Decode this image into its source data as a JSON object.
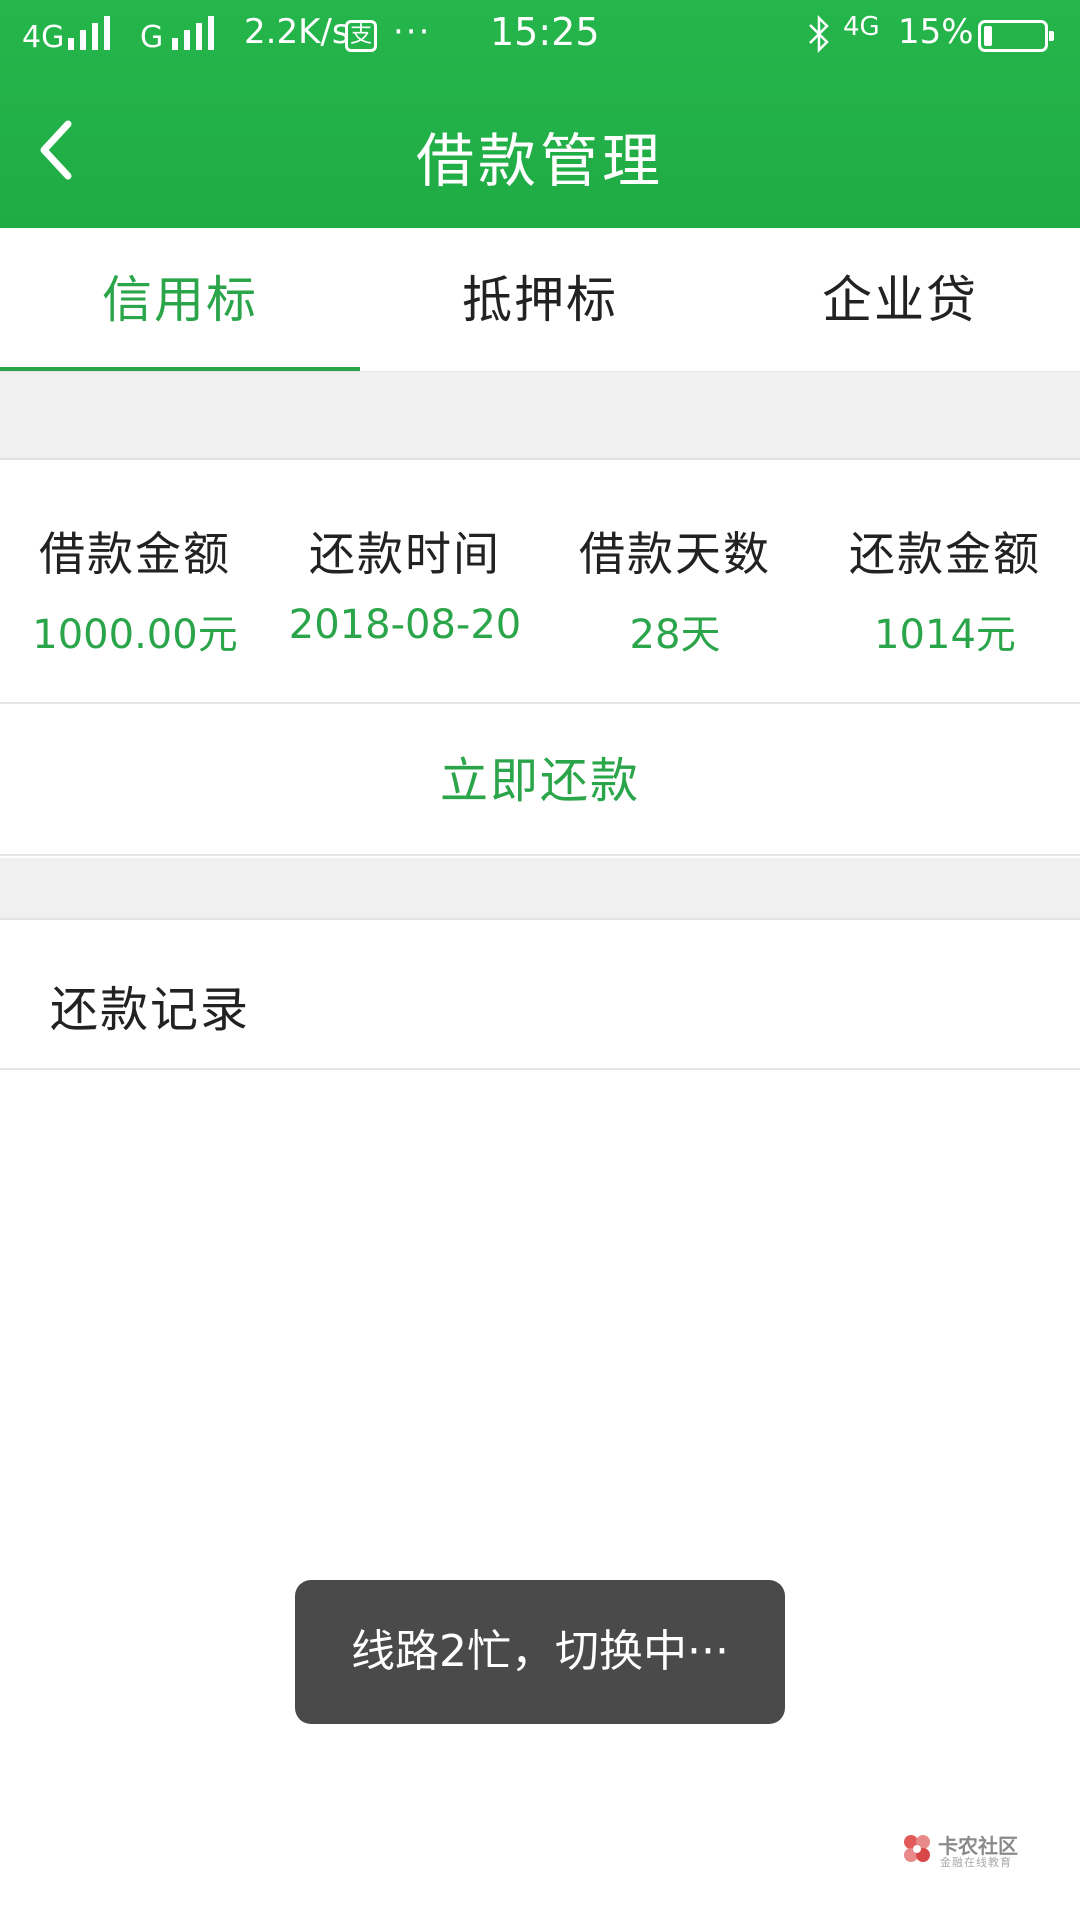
{
  "status_bar": {
    "network1": "4G",
    "network2": "G",
    "speed": "2.2K/s",
    "pay_icon_glyph": "支",
    "more": "···",
    "time": "15:25",
    "network3": "4G",
    "battery_percent": "15%"
  },
  "header": {
    "title": "借款管理",
    "back_icon": "chevron-left-icon"
  },
  "tabs": [
    {
      "label": "信用标",
      "active": true
    },
    {
      "label": "抵押标",
      "active": false
    },
    {
      "label": "企业贷",
      "active": false
    }
  ],
  "loan_info": [
    {
      "label": "借款金额",
      "value": "1000.00元"
    },
    {
      "label": "还款时间",
      "value": "2018-08-20"
    },
    {
      "label": "借款天数",
      "value": "28天"
    },
    {
      "label": "还款金额",
      "value": "1014元"
    }
  ],
  "repay_button": "立即还款",
  "repay_record": "还款记录",
  "toast": "线路2忙，切换中···",
  "watermark": {
    "title": "卡农社区",
    "subtitle": "金融在线教育"
  },
  "colors": {
    "header_green": "#22b049",
    "accent_green": "#2aa54a",
    "toast_bg": "#4a4a4a"
  }
}
